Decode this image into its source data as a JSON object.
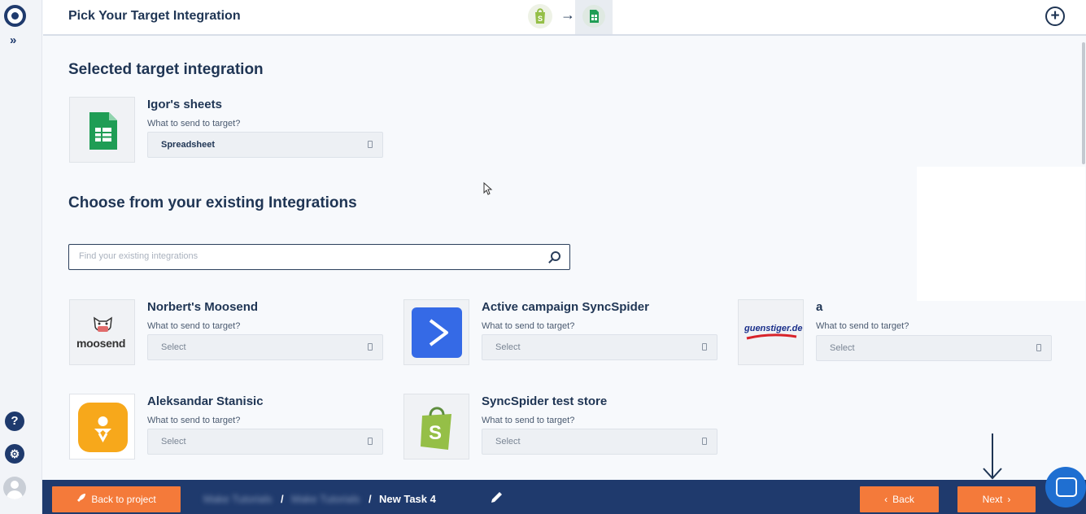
{
  "sidebar": {
    "expand_label": "»",
    "help_label": "?",
    "settings_label": "⚙"
  },
  "header": {
    "title": "Pick Your Target Integration",
    "arrow": "→",
    "add_label": "+"
  },
  "selected": {
    "heading": "Selected target integration",
    "name": "Igor's sheets",
    "question": "What to send to target?",
    "value": "Spreadsheet"
  },
  "existing": {
    "heading": "Choose from your existing Integrations",
    "search_placeholder": "Find your existing integrations",
    "items": [
      {
        "name": "Norbert's Moosend",
        "question": "What to send to target?",
        "value": "Select",
        "logo_text": "moosend"
      },
      {
        "name": "Active campaign SyncSpider",
        "question": "What to send to target?",
        "value": "Select"
      },
      {
        "name": "a",
        "question": "What to send to target?",
        "value": "Select",
        "logo_text": "guenstiger.de"
      },
      {
        "name": "Aleksandar Stanisic",
        "question": "What to send to target?",
        "value": "Select"
      },
      {
        "name": "SyncSpider test store",
        "question": "What to send to target?",
        "value": "Select"
      }
    ]
  },
  "footer": {
    "back_to_project": "Back to project",
    "crumb_1": "Make Tutorials",
    "crumb_sep": "/",
    "crumb_2": "Make Tutorials",
    "task": "New Task 4",
    "back": "Back",
    "next": "Next"
  },
  "colors": {
    "navy": "#1f3a6d",
    "orange": "#f47a3a",
    "sheets_green": "#1f9d55",
    "shopify_green": "#95bf47",
    "activecampaign_blue": "#356ae6"
  }
}
